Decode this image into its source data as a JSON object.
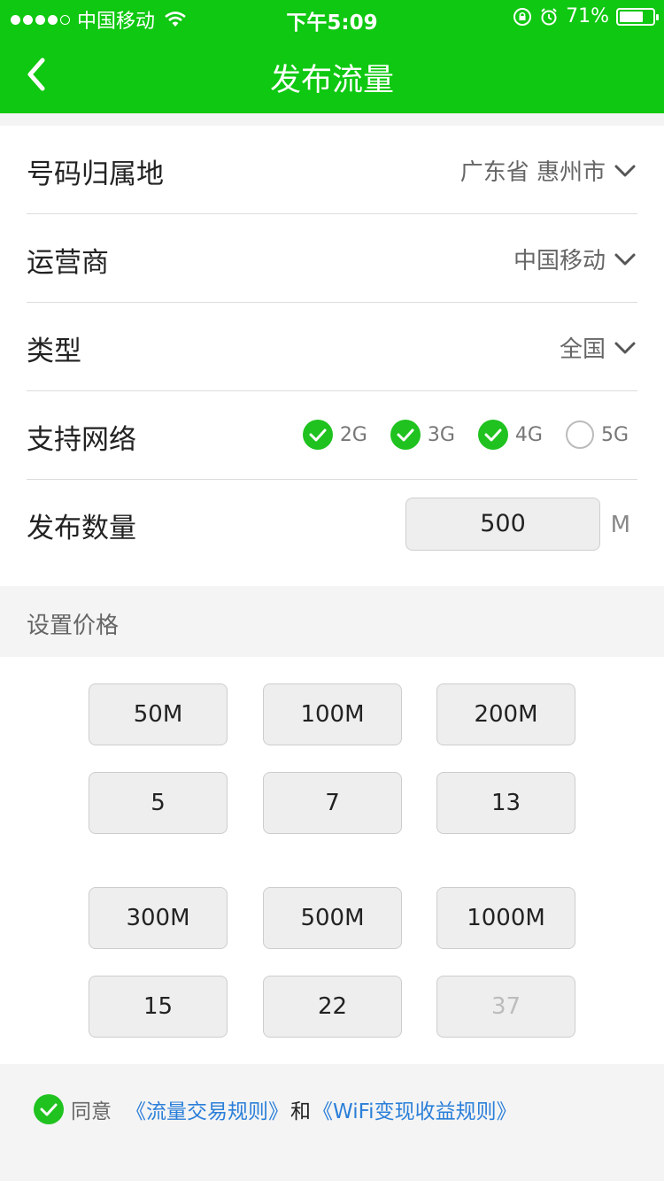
{
  "status_bar": {
    "carrier": "中国移动",
    "time": "下午5:09",
    "battery": "71%",
    "battery_level": 0.71
  },
  "header": {
    "title": "发布流量"
  },
  "form": {
    "region": {
      "label": "号码归属地",
      "value": "广东省 惠州市"
    },
    "operator": {
      "label": "运营商",
      "value": "中国移动"
    },
    "type": {
      "label": "类型",
      "value": "全国"
    },
    "network": {
      "label": "支持网络",
      "options": [
        {
          "label": "2G",
          "checked": true
        },
        {
          "label": "3G",
          "checked": true
        },
        {
          "label": "4G",
          "checked": true
        },
        {
          "label": "5G",
          "checked": false
        }
      ]
    },
    "quantity": {
      "label": "发布数量",
      "value": "500",
      "unit": "M"
    }
  },
  "price_section": {
    "title": "设置价格",
    "groups": [
      {
        "sizes": [
          "50M",
          "100M",
          "200M"
        ],
        "prices": [
          "5",
          "7",
          "13"
        ]
      },
      {
        "sizes": [
          "300M",
          "500M",
          "1000M"
        ],
        "prices": [
          "15",
          "22",
          "37"
        ]
      }
    ]
  },
  "agreement": {
    "agree": "同意",
    "rule1": "《流量交易规则》",
    "and": "和",
    "rule2": "《WiFi变现收益规则》"
  },
  "colors": {
    "brand": "#0fc811",
    "check": "#1fc21f",
    "link": "#2b7fd9"
  }
}
